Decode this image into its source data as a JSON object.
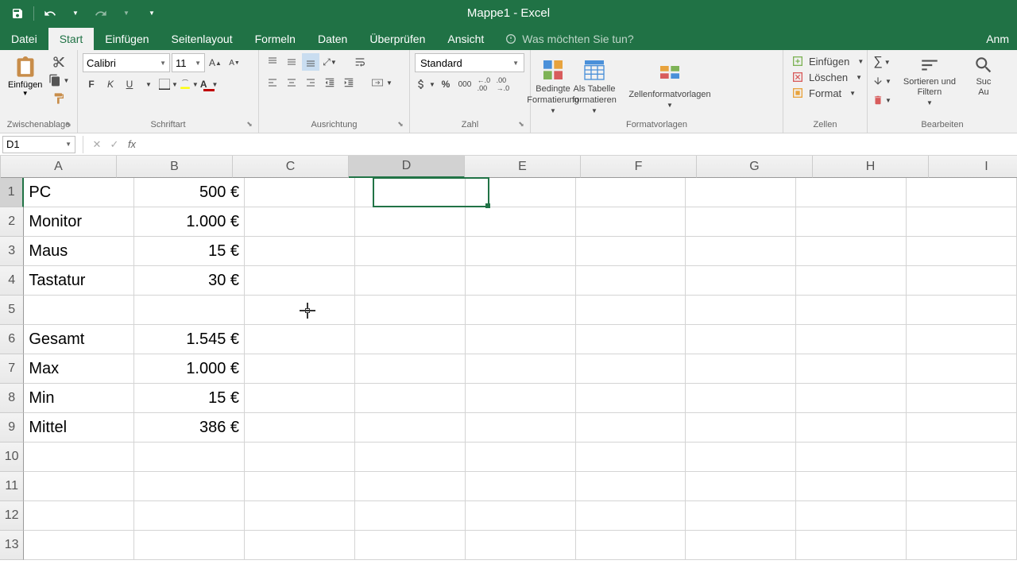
{
  "title": "Mappe1 - Excel",
  "tabs": {
    "file": "Datei",
    "start": "Start",
    "insert": "Einfügen",
    "layout": "Seitenlayout",
    "formulas": "Formeln",
    "data": "Daten",
    "review": "Überprüfen",
    "view": "Ansicht",
    "tellme": "Was möchten Sie tun?",
    "right": "Anm"
  },
  "ribbon": {
    "clipboard": {
      "paste": "Einfügen",
      "group": "Zwischenablage"
    },
    "font": {
      "name": "Calibri",
      "size": "11",
      "group": "Schriftart"
    },
    "align": {
      "group": "Ausrichtung"
    },
    "number": {
      "format": "Standard",
      "group": "Zahl"
    },
    "styles": {
      "cond": "Bedingte\nFormatierung",
      "table": "Als Tabelle\nformatieren",
      "cell": "Zellenformatvorlagen",
      "group": "Formatvorlagen"
    },
    "cells": {
      "insert": "Einfügen",
      "delete": "Löschen",
      "format": "Format",
      "group": "Zellen"
    },
    "editing": {
      "sort": "Sortieren und\nFiltern",
      "find": "Suc\nAu",
      "group": "Bearbeiten"
    }
  },
  "namebox": "D1",
  "columns": [
    "A",
    "B",
    "C",
    "D",
    "E",
    "F",
    "G",
    "H",
    "I"
  ],
  "col_widths": [
    "wA",
    "wB",
    "wC",
    "wD",
    "wE",
    "wF",
    "wG",
    "wH",
    "wI"
  ],
  "rows": [
    {
      "n": 1,
      "A": "PC",
      "B": "500 €"
    },
    {
      "n": 2,
      "A": "Monitor",
      "B": "1.000 €"
    },
    {
      "n": 3,
      "A": "Maus",
      "B": "15 €"
    },
    {
      "n": 4,
      "A": "Tastatur",
      "B": "30 €"
    },
    {
      "n": 5,
      "A": "",
      "B": ""
    },
    {
      "n": 6,
      "A": "Gesamt",
      "B": "1.545 €"
    },
    {
      "n": 7,
      "A": "Max",
      "B": "1.000 €"
    },
    {
      "n": 8,
      "A": "Min",
      "B": "15 €"
    },
    {
      "n": 9,
      "A": "Mittel",
      "B": "386 €"
    },
    {
      "n": 10,
      "A": "",
      "B": ""
    },
    {
      "n": 11,
      "A": "",
      "B": ""
    },
    {
      "n": 12,
      "A": "",
      "B": ""
    },
    {
      "n": 13,
      "A": "",
      "B": ""
    }
  ],
  "selected": {
    "col": "D",
    "row": 1
  }
}
